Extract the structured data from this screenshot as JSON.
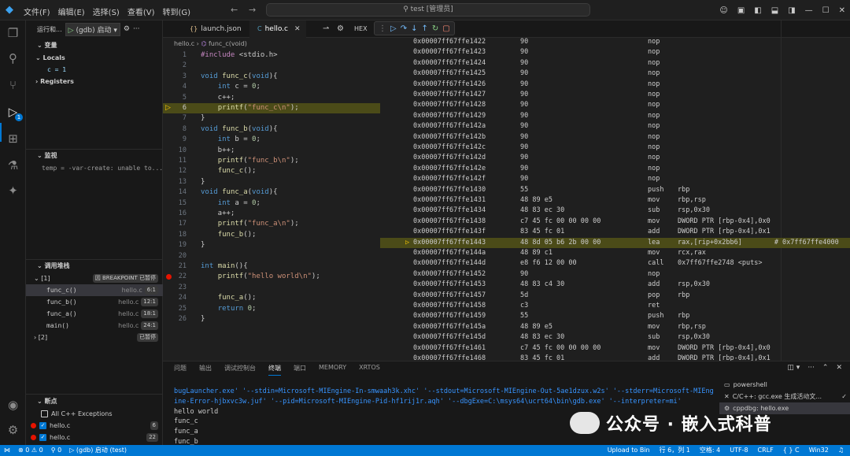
{
  "titlebar": {
    "menus": [
      "文件(F)",
      "编辑(E)",
      "选择(S)",
      "查看(V)",
      "转到(G)"
    ],
    "search": "test [管理员]",
    "back": "←",
    "forward": "→"
  },
  "debug": {
    "run_label": "运行和...",
    "config": "(gdb) 启动",
    "variables_header": "变量",
    "locals_label": "Locals",
    "local_var": "c = 1",
    "registers_label": "Registers",
    "watch_header": "监视",
    "watch_item": "temp = -var-create: unable to...",
    "callstack_header": "调用堆栈",
    "thread1": "[1]",
    "thread1_status": "因 BREAKPOINT 已暂停",
    "frames": [
      {
        "fn": "func_c()",
        "file": "hello.c",
        "line": "6:1"
      },
      {
        "fn": "func_b()",
        "file": "hello.c",
        "line": "12:1"
      },
      {
        "fn": "func_a()",
        "file": "hello.c",
        "line": "18:1"
      },
      {
        "fn": "main()",
        "file": "hello.c",
        "line": "24:1"
      }
    ],
    "thread2": "[2]",
    "thread2_status": "已暂停",
    "breakpoints_header": "断点",
    "bp_all": "All C++ Exceptions",
    "bp1": {
      "name": "hello.c",
      "line": "6"
    },
    "bp2": {
      "name": "hello.c",
      "line": "22"
    }
  },
  "editorA": {
    "tab1": "launch.json",
    "tab2": "hello.c",
    "breadcrumb_file": "hello.c",
    "breadcrumb_fn": "func_c(void)",
    "lines": [
      {
        "n": "1",
        "t": "#include <stdio.h>"
      },
      {
        "n": "2",
        "t": ""
      },
      {
        "n": "3",
        "t": "void func_c(void){"
      },
      {
        "n": "4",
        "t": "    int c = 0;"
      },
      {
        "n": "5",
        "t": "    c++;"
      },
      {
        "n": "6",
        "t": "    printf(\"func_c\\n\");"
      },
      {
        "n": "7",
        "t": "}"
      },
      {
        "n": "8",
        "t": "void func_b(void){"
      },
      {
        "n": "9",
        "t": "    int b = 0;"
      },
      {
        "n": "10",
        "t": "    b++;"
      },
      {
        "n": "11",
        "t": "    printf(\"func_b\\n\");"
      },
      {
        "n": "12",
        "t": "    func_c();"
      },
      {
        "n": "13",
        "t": "}"
      },
      {
        "n": "14",
        "t": "void func_a(void){"
      },
      {
        "n": "15",
        "t": "    int a = 0;"
      },
      {
        "n": "16",
        "t": "    a++;"
      },
      {
        "n": "17",
        "t": "    printf(\"func_a\\n\");"
      },
      {
        "n": "18",
        "t": "    func_b();"
      },
      {
        "n": "19",
        "t": "}"
      },
      {
        "n": "20",
        "t": ""
      },
      {
        "n": "21",
        "t": "int main(){"
      },
      {
        "n": "22",
        "t": "    printf(\"hello world\\n\");"
      },
      {
        "n": "23",
        "t": ""
      },
      {
        "n": "24",
        "t": "    func_a();"
      },
      {
        "n": "25",
        "t": "    return 0;"
      },
      {
        "n": "26",
        "t": "}"
      }
    ]
  },
  "disasm": {
    "hex_label": "HEX",
    "rows": [
      {
        "a": "0x00007ff67ffe1422",
        "b": "90",
        "m": "nop",
        "o": ""
      },
      {
        "a": "0x00007ff67ffe1423",
        "b": "90",
        "m": "nop",
        "o": ""
      },
      {
        "a": "0x00007ff67ffe1424",
        "b": "90",
        "m": "nop",
        "o": ""
      },
      {
        "a": "0x00007ff67ffe1425",
        "b": "90",
        "m": "nop",
        "o": ""
      },
      {
        "a": "0x00007ff67ffe1426",
        "b": "90",
        "m": "nop",
        "o": ""
      },
      {
        "a": "0x00007ff67ffe1427",
        "b": "90",
        "m": "nop",
        "o": ""
      },
      {
        "a": "0x00007ff67ffe1428",
        "b": "90",
        "m": "nop",
        "o": ""
      },
      {
        "a": "0x00007ff67ffe1429",
        "b": "90",
        "m": "nop",
        "o": ""
      },
      {
        "a": "0x00007ff67ffe142a",
        "b": "90",
        "m": "nop",
        "o": ""
      },
      {
        "a": "0x00007ff67ffe142b",
        "b": "90",
        "m": "nop",
        "o": ""
      },
      {
        "a": "0x00007ff67ffe142c",
        "b": "90",
        "m": "nop",
        "o": ""
      },
      {
        "a": "0x00007ff67ffe142d",
        "b": "90",
        "m": "nop",
        "o": ""
      },
      {
        "a": "0x00007ff67ffe142e",
        "b": "90",
        "m": "nop",
        "o": ""
      },
      {
        "a": "0x00007ff67ffe142f",
        "b": "90",
        "m": "nop",
        "o": ""
      },
      {
        "a": "0x00007ff67ffe1430",
        "b": "55",
        "m": "push",
        "o": "rbp"
      },
      {
        "a": "0x00007ff67ffe1431",
        "b": "48 89 e5",
        "m": "mov",
        "o": "rbp,rsp"
      },
      {
        "a": "0x00007ff67ffe1434",
        "b": "48 83 ec 30",
        "m": "sub",
        "o": "rsp,0x30"
      },
      {
        "a": "0x00007ff67ffe1438",
        "b": "c7 45 fc 00 00 00 00",
        "m": "mov",
        "o": "DWORD PTR [rbp-0x4],0x0"
      },
      {
        "a": "0x00007ff67ffe143f",
        "b": "83 45 fc 01",
        "m": "add",
        "o": "DWORD PTR [rbp-0x4],0x1"
      },
      {
        "a": "0x00007ff67ffe1443",
        "b": "48 8d 05 b6 2b 00 00",
        "m": "lea",
        "o": "rax,[rip+0x2bb6]        # 0x7ff67ffe4000"
      },
      {
        "a": "0x00007ff67ffe144a",
        "b": "48 89 c1",
        "m": "mov",
        "o": "rcx,rax"
      },
      {
        "a": "0x00007ff67ffe144d",
        "b": "e8 f6 12 00 00",
        "m": "call",
        "o": "0x7ff67ffe2748 <puts>"
      },
      {
        "a": "0x00007ff67ffe1452",
        "b": "90",
        "m": "nop",
        "o": ""
      },
      {
        "a": "0x00007ff67ffe1453",
        "b": "48 83 c4 30",
        "m": "add",
        "o": "rsp,0x30"
      },
      {
        "a": "0x00007ff67ffe1457",
        "b": "5d",
        "m": "pop",
        "o": "rbp"
      },
      {
        "a": "0x00007ff67ffe1458",
        "b": "c3",
        "m": "ret",
        "o": ""
      },
      {
        "a": "0x00007ff67ffe1459",
        "b": "55",
        "m": "push",
        "o": "rbp"
      },
      {
        "a": "0x00007ff67ffe145a",
        "b": "48 89 e5",
        "m": "mov",
        "o": "rbp,rsp"
      },
      {
        "a": "0x00007ff67ffe145d",
        "b": "48 83 ec 30",
        "m": "sub",
        "o": "rsp,0x30"
      },
      {
        "a": "0x00007ff67ffe1461",
        "b": "c7 45 fc 00 00 00 00",
        "m": "mov",
        "o": "DWORD PTR [rbp-0x4],0x0"
      },
      {
        "a": "0x00007ff67ffe1468",
        "b": "83 45 fc 01",
        "m": "add",
        "o": "DWORD PTR [rbp-0x4],0x1"
      }
    ]
  },
  "panel": {
    "tabs": [
      "问题",
      "输出",
      "调试控制台",
      "终端",
      "端口",
      "MEMORY",
      "XRTOS"
    ],
    "term_lines": [
      "bugLauncher.exe' '--stdin=Microsoft-MIEngine-In-smwaah3k.xhc' '--stdout=Microsoft-MIEngine-Out-5ae1dzux.w2s' '--stderr=Microsoft-MIEng",
      "ine-Error-hjbxvc3w.juf' '--pid=Microsoft-MIEngine-Pid-hf1rij1r.aqh' '--dbgExe=C:\\msys64\\ucrt64\\bin\\gdb.exe' '--interpreter=mi'",
      "hello world",
      "func_c",
      "func_a",
      "func_b"
    ],
    "shells": [
      "powershell",
      "C/C++: gcc.exe 生成活动文...",
      "cppdbg: hello.exe"
    ]
  },
  "watermark": "公众号 · 嵌入式科普",
  "statusbar": {
    "errors": "⊗ 0  ⚠ 0",
    "ports": "⚲ 0",
    "debug": "▷ (gdb) 启动 (test)",
    "upload": "Upload to Bin",
    "position": "行 6，列 1",
    "spaces": "空格: 4",
    "encoding": "UTF-8",
    "eol": "CRLF",
    "lang": "{ } C",
    "platform": "Win32"
  },
  "colors": {
    "accent": "#0078d4",
    "highlight": "#4b4b18",
    "breakpoint": "#e51400"
  }
}
